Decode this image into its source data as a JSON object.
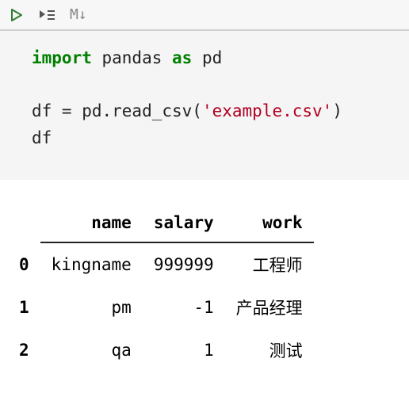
{
  "toolbar": {
    "run_icon": "run-icon",
    "run_by_line_icon": "run-by-line-icon",
    "markdown_label": "M↓"
  },
  "code": {
    "kw_import": "import",
    "pandas": " pandas ",
    "kw_as": "as",
    "pd": " pd",
    "line3_pre": "df = pd.read_csv(",
    "line3_str": "'example.csv'",
    "line3_post": ")",
    "line4": "df"
  },
  "table": {
    "columns": [
      "name",
      "salary",
      "work"
    ],
    "index": [
      "0",
      "1",
      "2"
    ],
    "rows": [
      {
        "name": "kingname",
        "salary": "999999",
        "work": "工程师"
      },
      {
        "name": "pm",
        "salary": "-1",
        "work": "产品经理"
      },
      {
        "name": "qa",
        "salary": "1",
        "work": "测试"
      }
    ]
  }
}
